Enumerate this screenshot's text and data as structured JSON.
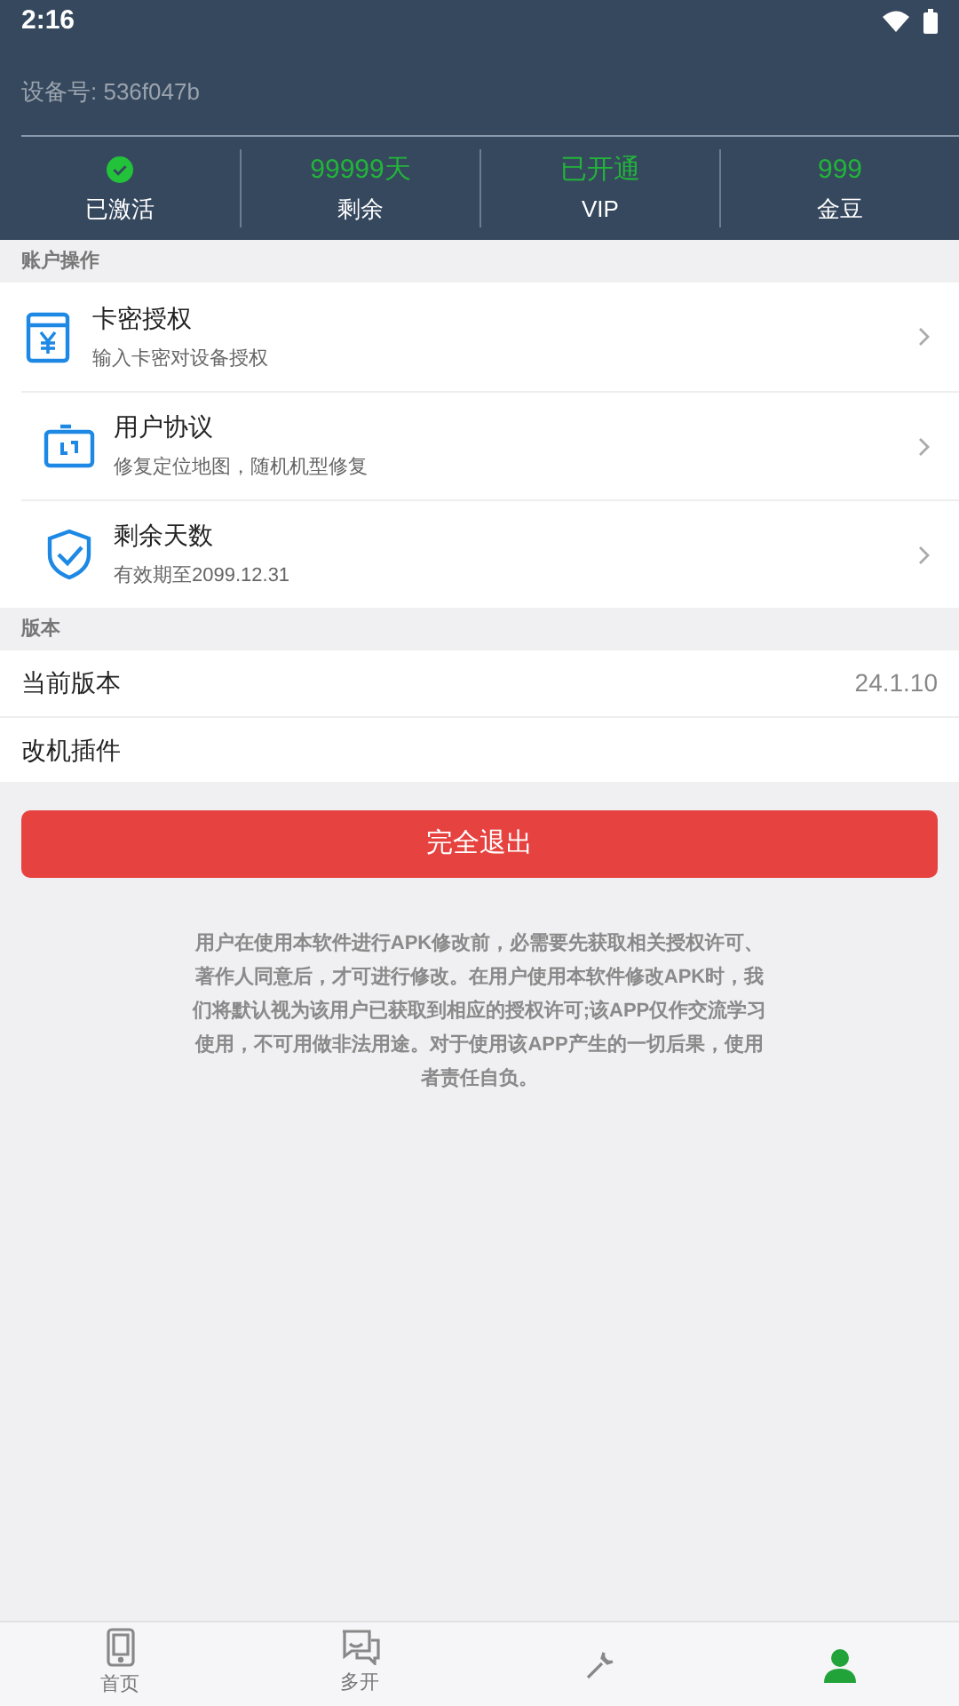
{
  "status_bar": {
    "time": "2:16"
  },
  "device": {
    "label": "设备号: 536f047b"
  },
  "stats": [
    {
      "kind": "icon",
      "label": "已激活",
      "checked": true
    },
    {
      "kind": "text",
      "value": "99999天",
      "label": "剩余"
    },
    {
      "kind": "text",
      "value": "已开通",
      "label": "VIP"
    },
    {
      "kind": "text",
      "value": "999",
      "label": "金豆"
    }
  ],
  "sections": [
    {
      "title": "账户操作",
      "items": [
        {
          "kind": "card",
          "title": "卡密授权",
          "subtitle": "输入卡密对设备授权"
        },
        {
          "kind": "sync",
          "title": "用户协议",
          "subtitle": "修复定位地图，随机机型修复"
        },
        {
          "kind": "shield",
          "title": "剩余天数",
          "subtitle": "有效期至2099.12.31"
        }
      ]
    },
    {
      "title": "版本",
      "items": [
        {
          "kind": "plain",
          "title": "当前版本",
          "value": "24.1.10"
        },
        {
          "kind": "plain",
          "title": "改机插件"
        }
      ]
    }
  ],
  "exit_button": "完全退出",
  "disclaimer": "用户在使用本软件进行APK修改前，必需要先获取相关授权许可、著作人同意后，才可进行修改。在用户使用本软件修改APK时，我们将默认视为该用户已获取到相应的授权许可;该APP仅作交流学习使用，不可用做非法用途。对于使用该APP产生的一切后果，使用者责任自负。",
  "tabs": [
    {
      "kind": "phone",
      "label": "首页",
      "selected": false
    },
    {
      "kind": "chat",
      "label": "多开",
      "selected": false
    },
    {
      "kind": "tool",
      "selected": false
    },
    {
      "kind": "person",
      "selected": true
    }
  ]
}
